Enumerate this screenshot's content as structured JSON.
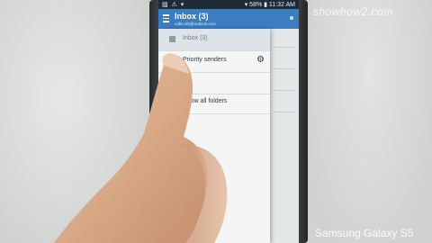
{
  "watermark": "showhow2.com",
  "device_label": "Samsung Galaxy S5",
  "status_bar": {
    "left_icons": "▨ ⚠ ▾",
    "right_text": "▾ 58% ▮ 11:32 AM"
  },
  "app_bar": {
    "title": "Inbox (3)",
    "subtitle": "cdbb.sth@outlook.com",
    "menu_icon": "hamburger-icon"
  },
  "drawer": {
    "items": [
      {
        "label": "Inbox (3)",
        "icon": "inbox-icon"
      },
      {
        "label": "Priority senders",
        "icon": "star-icon",
        "settings_icon": "gear-icon"
      },
      {
        "label": ""
      },
      {
        "label": "Show all folders"
      }
    ]
  },
  "colors": {
    "app_bar": "#3a7ec0",
    "status_bar": "#1c2b37",
    "drawer_bg": "#f4f5f5",
    "selected_row": "#dde3e8"
  }
}
